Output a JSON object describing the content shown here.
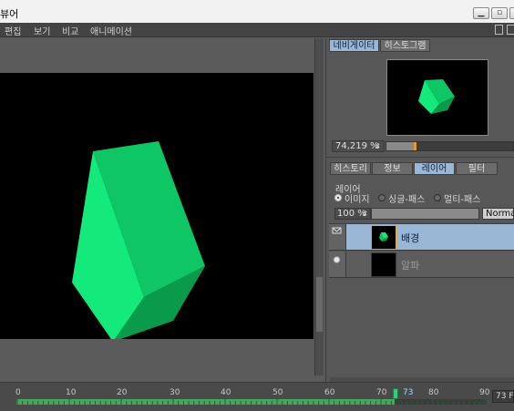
{
  "window": {
    "title": "뷰어"
  },
  "menu": [
    "편집",
    "보기",
    "비교",
    "애니메이션"
  ],
  "navigator": {
    "tabs": [
      {
        "label": "네비게이터",
        "active": true
      },
      {
        "label": "히스토그램",
        "active": false
      }
    ],
    "zoom": "74,219 %"
  },
  "layers_panel": {
    "tabs": [
      {
        "label": "히스토리",
        "active": false
      },
      {
        "label": "정보",
        "active": false
      },
      {
        "label": "레이어",
        "active": true
      },
      {
        "label": "필터",
        "active": false
      }
    ],
    "section_label": "레이어",
    "modes": [
      {
        "label": "이미지",
        "selected": true
      },
      {
        "label": "싱글-패스",
        "selected": false
      },
      {
        "label": "멀티-패스",
        "selected": false
      }
    ],
    "opacity": "100 %",
    "blend_mode": "Normal",
    "layers": [
      {
        "name": "배경",
        "selected": true
      },
      {
        "name": "알파",
        "selected": false
      }
    ]
  },
  "timeline": {
    "ticks": [
      "0",
      "10",
      "20",
      "30",
      "40",
      "50",
      "60",
      "70",
      "73",
      "80",
      "90"
    ],
    "current_frame": "73",
    "end_frame": "73 F",
    "progress": 0.8
  },
  "colors": {
    "cube_light": "#13ea7b",
    "cube_mid": "#0fc664",
    "cube_dark": "#0a9a4c",
    "accent": "#9ab7d6",
    "selected_layer": "#9ab7d6",
    "playhead": "#2fd07a"
  }
}
